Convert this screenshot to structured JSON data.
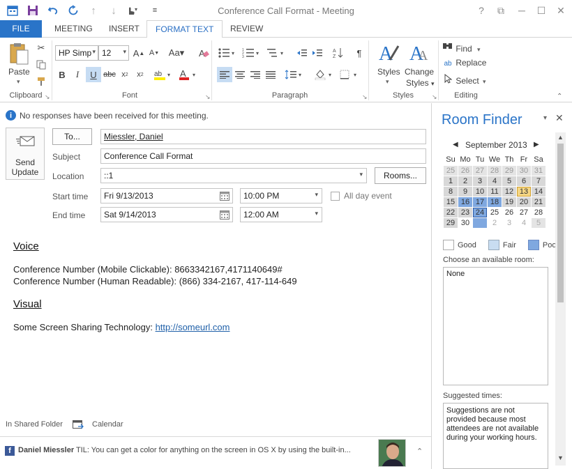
{
  "window": {
    "title": "Conference Call Format - Meeting",
    "help": "?",
    "restore": "⧉",
    "minimize": "─",
    "maximize": "☐",
    "close": "✕"
  },
  "tabs": [
    "FILE",
    "MEETING",
    "INSERT",
    "FORMAT TEXT",
    "REVIEW"
  ],
  "active_tab": "FORMAT TEXT",
  "ribbon": {
    "clipboard": {
      "paste": "Paste",
      "label": "Clipboard"
    },
    "font": {
      "family": "HP Simp",
      "size": "12",
      "label": "Font"
    },
    "paragraph": {
      "label": "Paragraph"
    },
    "styles": {
      "styles": "Styles",
      "change": "Change",
      "styles2": "Styles",
      "label": "Styles"
    },
    "editing": {
      "find": "Find",
      "replace": "Replace",
      "select": "Select",
      "label": "Editing"
    }
  },
  "info_bar": "No responses have been received for this meeting.",
  "form": {
    "send": "Send",
    "update": "Update",
    "to_button": "To...",
    "to_value": "Miessler, Daniel",
    "subject_label": "Subject",
    "subject_value": "Conference Call Format",
    "location_label": "Location",
    "location_value": "::1",
    "rooms_button": "Rooms...",
    "start_label": "Start time",
    "start_date": "Fri 9/13/2013",
    "start_time": "10:00 PM",
    "all_day": "All day event",
    "end_label": "End time",
    "end_date": "Sat 9/14/2013",
    "end_time": "12:00 AM"
  },
  "body": {
    "voice_heading": "Voice",
    "line1": "Conference Number (Mobile Clickable): 8663342167,4171140649#",
    "line2": "Conference Number (Human Readable): (866) 334-2167, 417-114-649",
    "visual_heading": "Visual",
    "line3_prefix": "Some Screen Sharing Technology: ",
    "line3_link": "http://someurl.com"
  },
  "footer": {
    "folder": "In Shared Folder",
    "calendar": "Calendar",
    "person": "Daniel Miessler",
    "status": "TIL: You can get a color for anything on the screen in OS X by using the built-in..."
  },
  "room_finder": {
    "title": "Room Finder",
    "month": "September 2013",
    "days": [
      "Su",
      "Mo",
      "Tu",
      "We",
      "Th",
      "Fr",
      "Sa"
    ],
    "weeks": [
      [
        "25",
        "26",
        "27",
        "28",
        "29",
        "30",
        "31"
      ],
      [
        "1",
        "2",
        "3",
        "4",
        "5",
        "6",
        "7"
      ],
      [
        "8",
        "9",
        "10",
        "11",
        "12",
        "13",
        "14"
      ],
      [
        "15",
        "16",
        "17",
        "18",
        "19",
        "20",
        "21"
      ],
      [
        "22",
        "23",
        "24",
        "25",
        "26",
        "27",
        "28"
      ],
      [
        "29",
        "30",
        "",
        "2",
        "3",
        "4",
        "5"
      ]
    ],
    "legend_good": "Good",
    "legend_fair": "Fair",
    "legend_poor": "Poor",
    "choose_label": "Choose an available room:",
    "room_none": "None",
    "suggested_label": "Suggested times:",
    "suggestion_text": "Suggestions are not provided because most attendees are not available during your working hours."
  }
}
